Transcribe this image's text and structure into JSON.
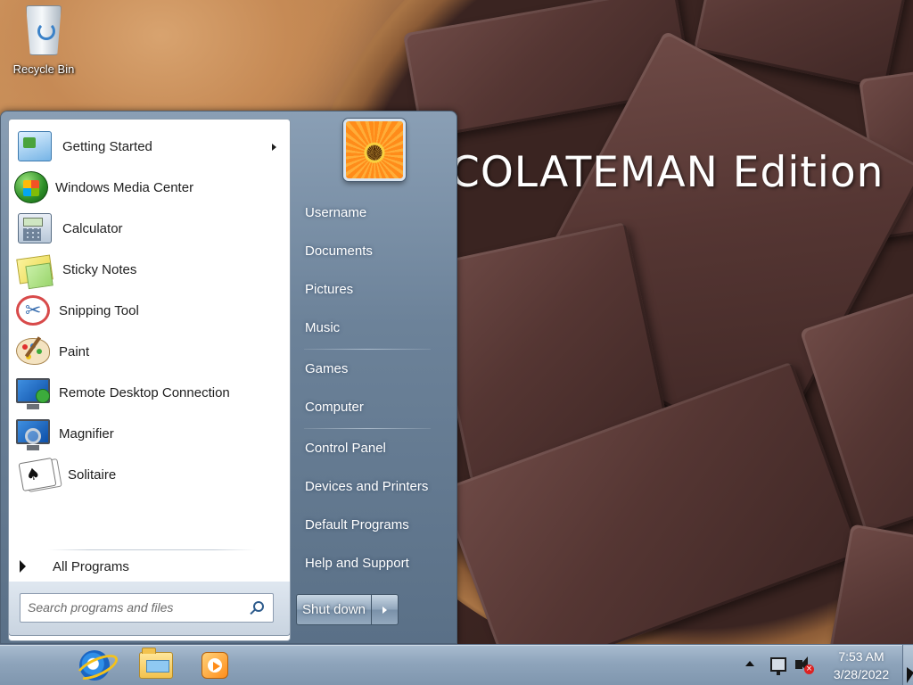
{
  "desktop": {
    "wallpaper_text": "COLATEMAN Edition",
    "icons": [
      {
        "label": "Recycle Bin",
        "icon": "recycle-bin-icon"
      }
    ]
  },
  "start_menu": {
    "programs": [
      {
        "label": "Getting Started",
        "icon": "getting-started-icon",
        "has_submenu": true
      },
      {
        "label": "Windows Media Center",
        "icon": "windows-media-center-icon"
      },
      {
        "label": "Calculator",
        "icon": "calculator-icon"
      },
      {
        "label": "Sticky Notes",
        "icon": "sticky-notes-icon"
      },
      {
        "label": "Snipping Tool",
        "icon": "snipping-tool-icon"
      },
      {
        "label": "Paint",
        "icon": "paint-icon"
      },
      {
        "label": "Remote Desktop Connection",
        "icon": "remote-desktop-icon"
      },
      {
        "label": "Magnifier",
        "icon": "magnifier-icon"
      },
      {
        "label": "Solitaire",
        "icon": "solitaire-icon"
      }
    ],
    "all_programs": "All Programs",
    "search_placeholder": "Search programs and files",
    "right_links": [
      "Username",
      "Documents",
      "Pictures",
      "Music",
      "Games",
      "Computer",
      "Control Panel",
      "Devices and Printers",
      "Default Programs",
      "Help and Support"
    ],
    "shutdown_label": "Shut down"
  },
  "taskbar": {
    "pinned": [
      {
        "name": "Internet Explorer",
        "icon": "internet-explorer-icon"
      },
      {
        "name": "Windows Explorer",
        "icon": "folder-icon"
      },
      {
        "name": "Windows Media Player",
        "icon": "media-player-icon"
      }
    ],
    "clock": {
      "time": "7:53 AM",
      "date": "3/28/2022"
    },
    "tray_icons": [
      "show-hidden-icons-icon",
      "network-icon",
      "volume-muted-icon"
    ]
  },
  "colors": {
    "start_menu_glass": "#7a90a8",
    "taskbar": "#8ea4bb",
    "chocolate": "#4a2e2b"
  }
}
